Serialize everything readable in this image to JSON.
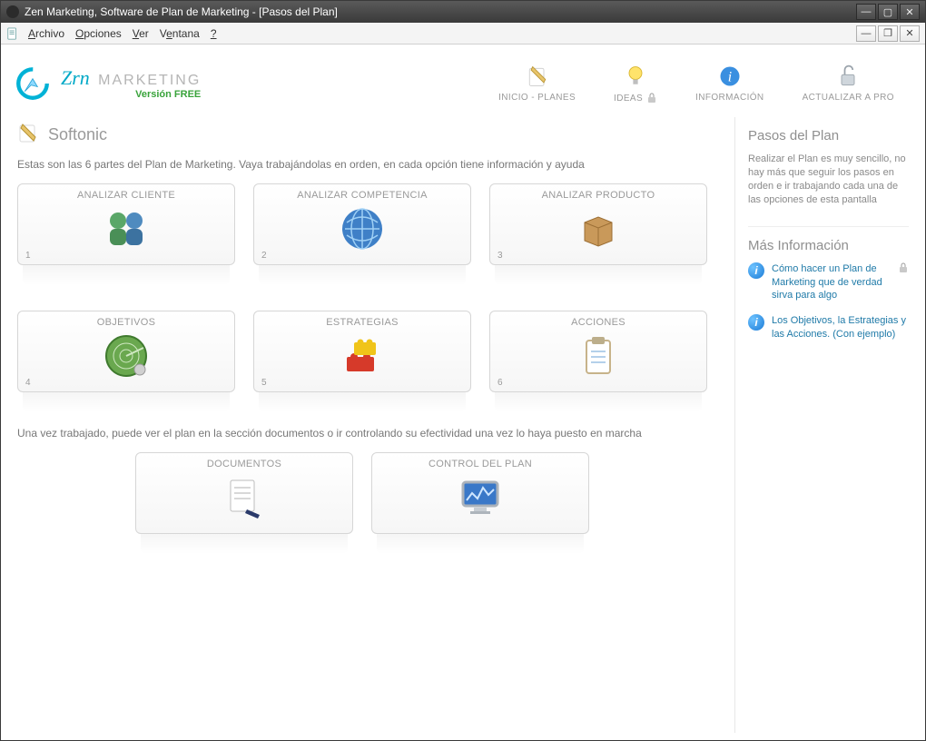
{
  "window": {
    "title": "Zen Marketing, Software de Plan de Marketing - [Pasos del Plan]"
  },
  "menus": {
    "archivo": "Archivo",
    "opciones": "Opciones",
    "ver": "Ver",
    "ventana": "Ventana",
    "help": "?"
  },
  "logo": {
    "zn": "Zrn",
    "marketing": "MARKETING",
    "version": "Versión FREE"
  },
  "topnav": {
    "inicio": "INICIO - PLANES",
    "ideas": "IDEAS",
    "informacion": "INFORMACIÓN",
    "actualizar": "ACTUALIZAR A PRO"
  },
  "page": {
    "title": "Softonic",
    "intro": "Estas son las 6 partes del Plan de Marketing. Vaya trabajándolas en orden, en cada opción tiene información y ayuda",
    "midtext": "Una vez trabajado, puede ver el plan en la sección documentos o ir controlando su efectividad una vez lo haya puesto en marcha"
  },
  "cards": [
    {
      "num": "1",
      "title": "ANALIZAR CLIENTE",
      "icon": "clients"
    },
    {
      "num": "2",
      "title": "ANALIZAR COMPETENCIA",
      "icon": "globe"
    },
    {
      "num": "3",
      "title": "ANALIZAR PRODUCTO",
      "icon": "boxes"
    },
    {
      "num": "4",
      "title": "OBJETIVOS",
      "icon": "radar"
    },
    {
      "num": "5",
      "title": "ESTRATEGIAS",
      "icon": "lego"
    },
    {
      "num": "6",
      "title": "ACCIONES",
      "icon": "clipboard"
    }
  ],
  "cards2": [
    {
      "title": "DOCUMENTOS",
      "icon": "document"
    },
    {
      "title": "CONTROL DEL PLAN",
      "icon": "monitor"
    }
  ],
  "sidebar": {
    "h1": "Pasos del Plan",
    "p1": "Realizar el Plan es muy sencillo, no hay más que seguir los pasos en orden e ir trabajando cada una de las opciones de esta pantalla",
    "h2": "Más Información",
    "links": [
      "Cómo hacer un Plan de Marketing que de verdad sirva para algo",
      "Los Objetivos, la Estrategias y las Acciones. (Con ejemplo)"
    ]
  }
}
